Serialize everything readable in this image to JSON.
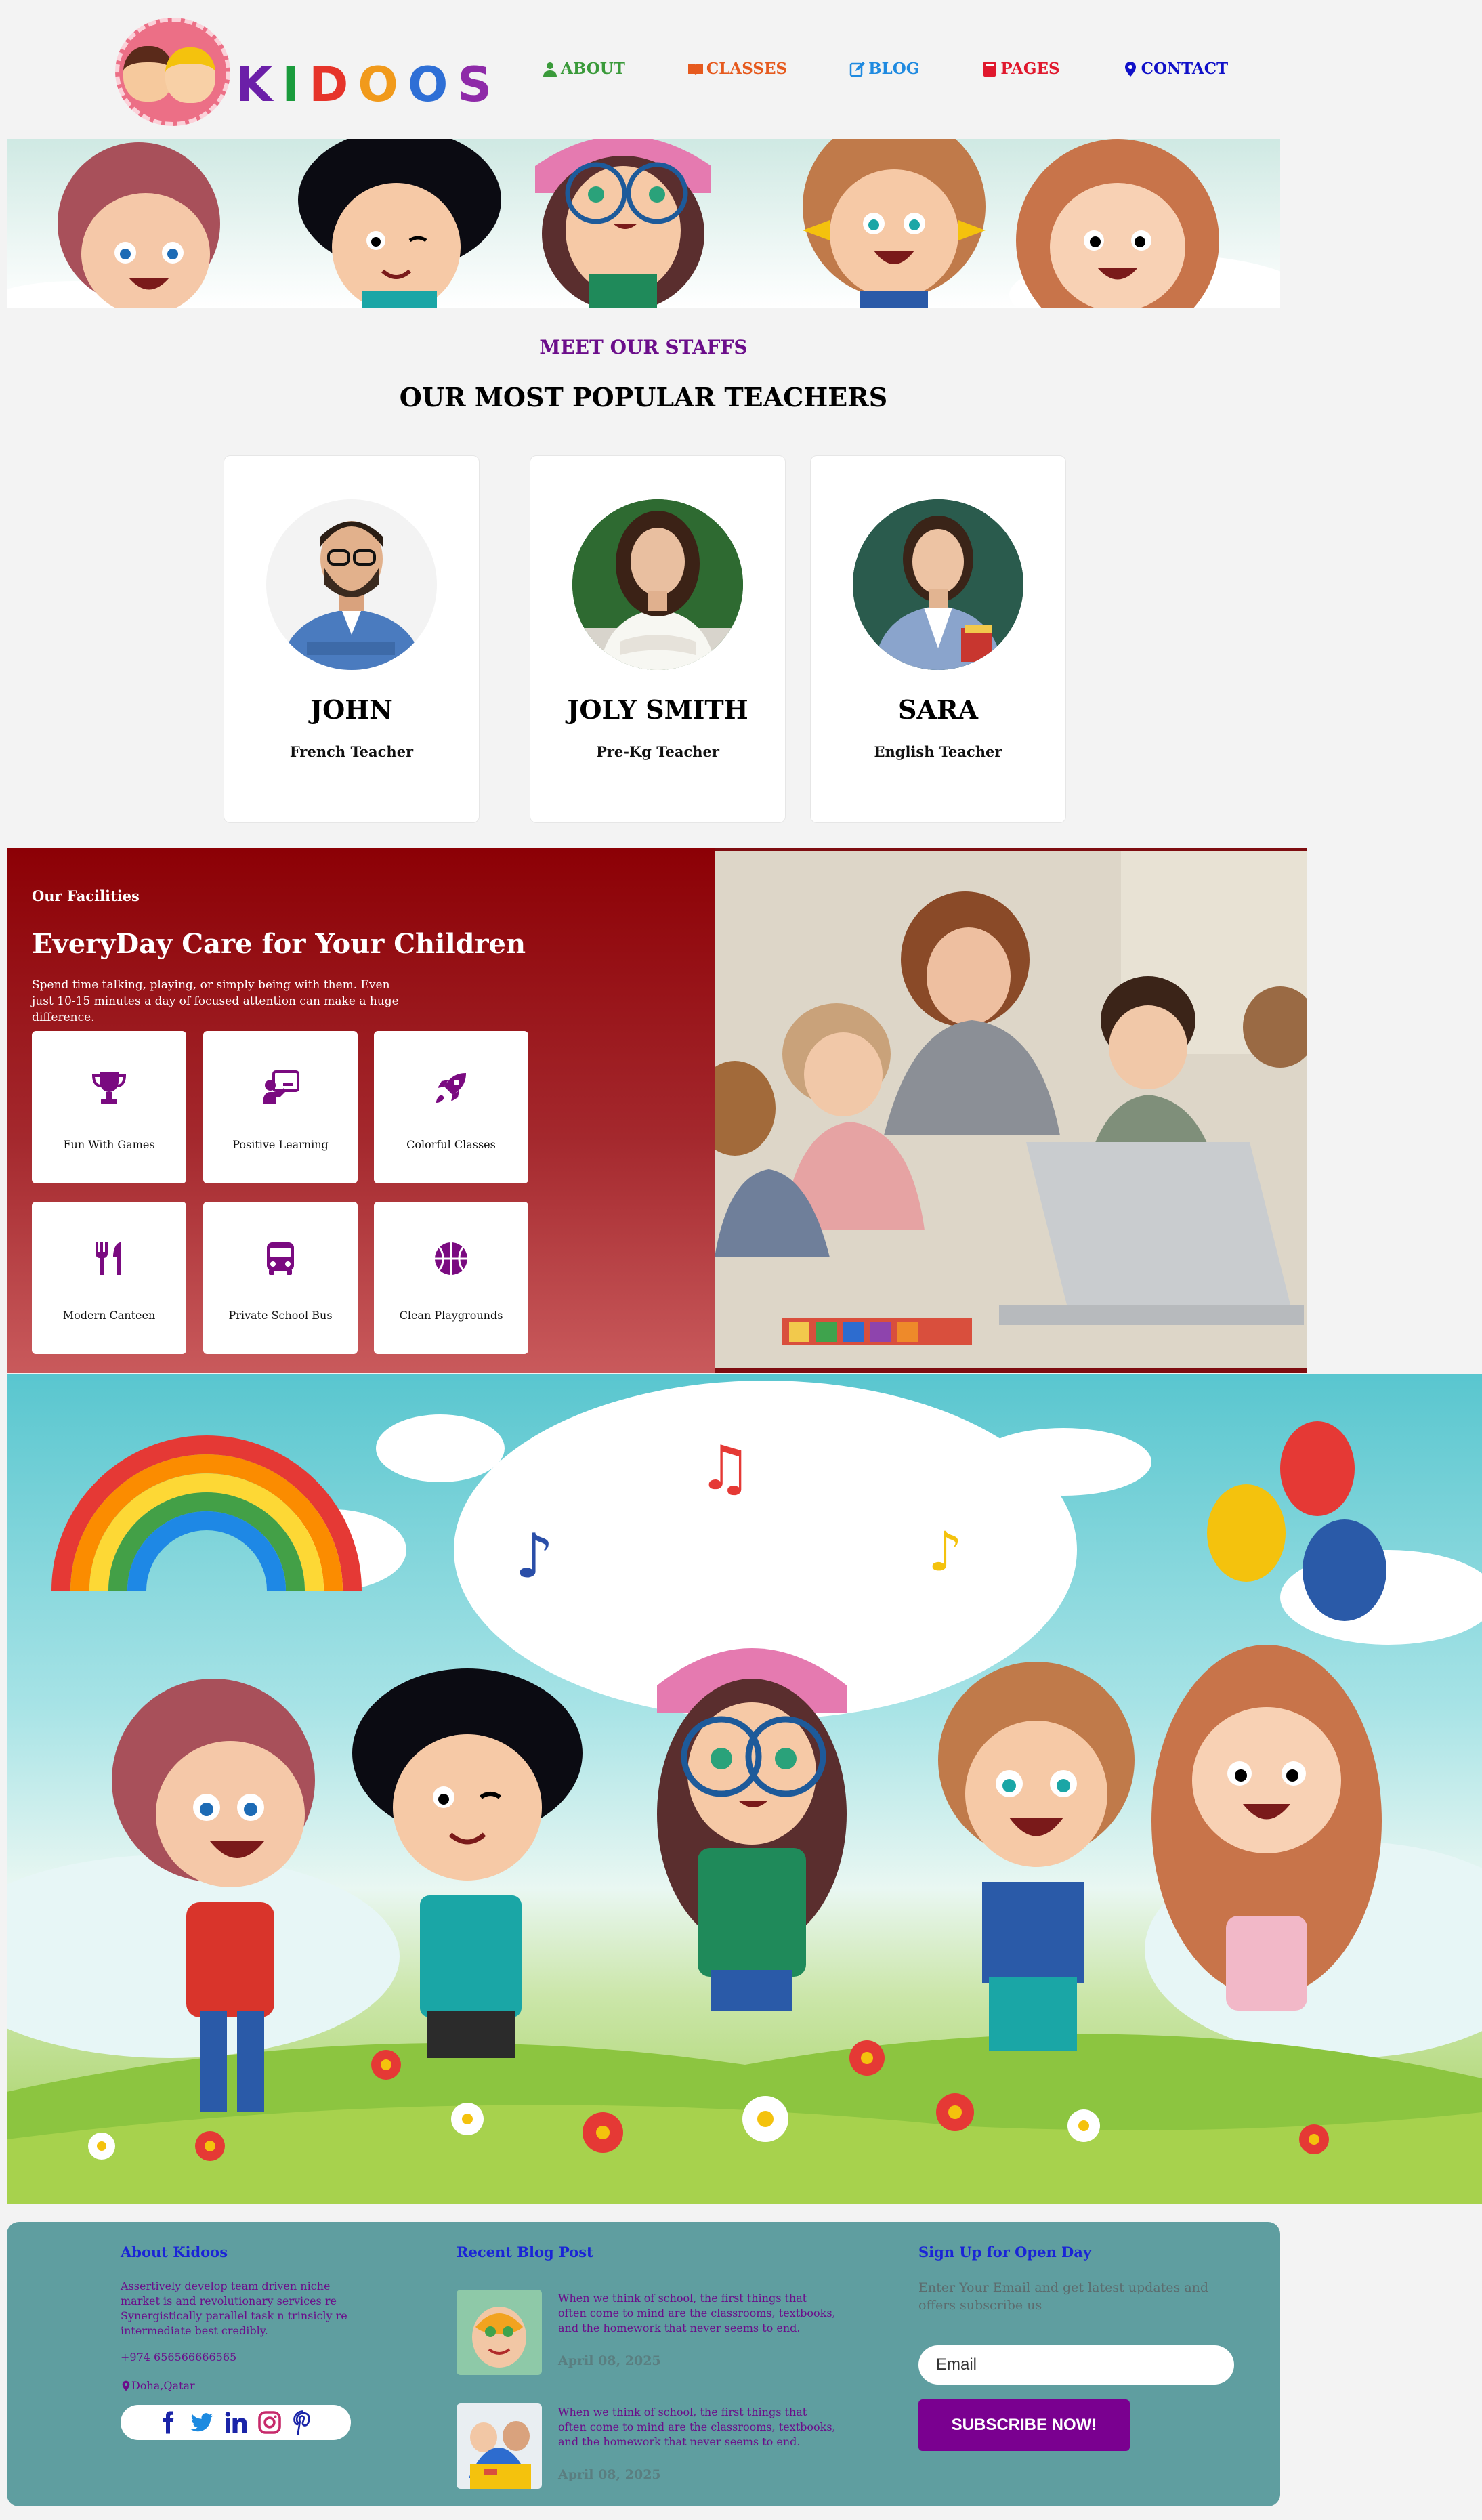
{
  "brand": {
    "name_letters": [
      "K",
      "I",
      "D",
      "O",
      "O",
      "S"
    ]
  },
  "nav": {
    "items": [
      {
        "label": "About",
        "icon": "user-icon",
        "color": "#3a9a3a"
      },
      {
        "label": "Classes",
        "icon": "book-open-icon",
        "color": "#e65a1e"
      },
      {
        "label": "Blog",
        "icon": "edit-icon",
        "color": "#1f8ae0"
      },
      {
        "label": "Pages",
        "icon": "book-icon",
        "color": "#e0182d"
      },
      {
        "label": "Contact",
        "icon": "map-marker-icon",
        "color": "#1010c8"
      }
    ]
  },
  "staff": {
    "subtitle": "MEET OUR STAFFS",
    "title": "OUR MOST POPULAR TEACHERS",
    "teachers": [
      {
        "name": "JOHN",
        "role": "French Teacher"
      },
      {
        "name": "JOLY SMITH",
        "role": "Pre-Kg Teacher"
      },
      {
        "name": "SARA",
        "role": "English Teacher"
      }
    ]
  },
  "facilities": {
    "kicker": "Our Facilities",
    "title": "EveryDay Care for Your Children",
    "description": "Spend time talking, playing, or simply being with them. Even just 10-15 minutes a day of focused attention can make a huge difference.",
    "items": [
      {
        "label": "Fun With Games",
        "icon": "trophy-icon"
      },
      {
        "label": "Positive Learning",
        "icon": "teacher-board-icon"
      },
      {
        "label": "Colorful Classes",
        "icon": "rocket-icon"
      },
      {
        "label": "Modern Canteen",
        "icon": "utensils-icon"
      },
      {
        "label": "Private School Bus",
        "icon": "bus-icon"
      },
      {
        "label": "Clean Playgrounds",
        "icon": "basketball-icon"
      }
    ],
    "icon_color": "#7a0a80"
  },
  "footer": {
    "about": {
      "title": "About Kidoos",
      "text": "Assertively develop team driven niche market is and revolutionary services re Synergistically parallel task n trinsicly re intermediate best credibly.",
      "phone": "+974 656566666565",
      "location": "Doha,Qatar"
    },
    "blog": {
      "title": "Recent Blog Post",
      "posts": [
        {
          "text": "When we think of school, the first things that often come to mind are the classrooms, textbooks, and the homework that never seems to end.",
          "date": "April 08, 2025"
        },
        {
          "text": "When we think of school, the first things that often come to mind are the classrooms, textbooks, and the homework that never seems to end.",
          "date": "April 08, 2025"
        }
      ]
    },
    "signup": {
      "title": "Sign Up for Open Day",
      "text": "Enter Your Email and get latest updates and offers subscribe us",
      "email_placeholder": "Email",
      "button_label": "SUBSCRIBE NOW!"
    },
    "social_icons": [
      "facebook-icon",
      "twitter-icon",
      "linkedin-icon",
      "instagram-icon",
      "pinterest-icon"
    ]
  }
}
